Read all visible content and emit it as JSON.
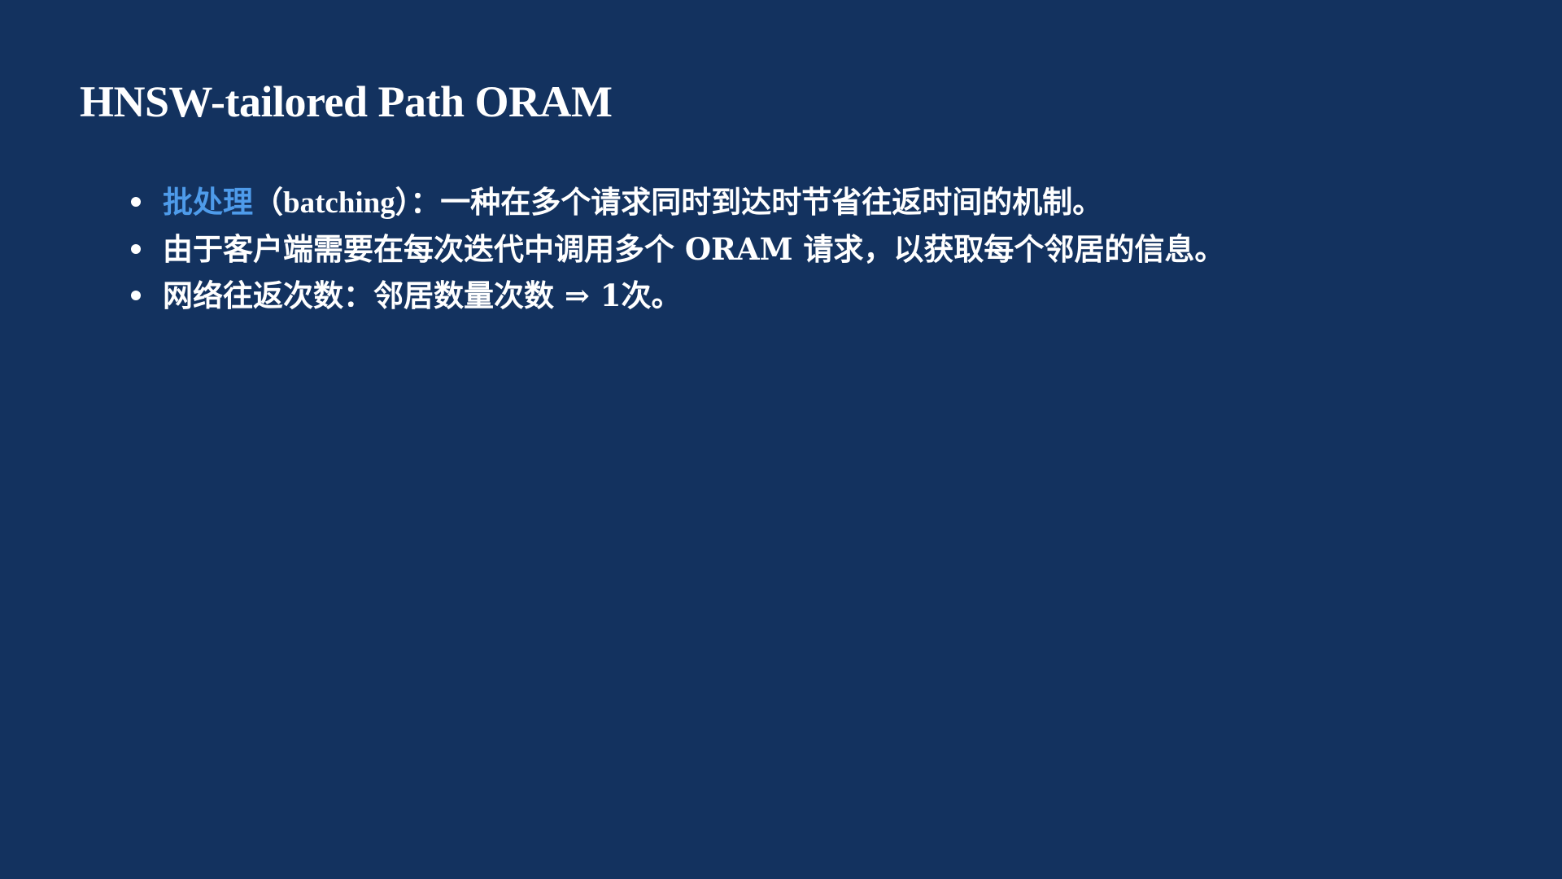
{
  "slide": {
    "title": "HNSW-tailored Path ORAM",
    "bullets": [
      {
        "highlight": "批处理",
        "paren": "（batching）",
        "rest": "：一种在多个请求同时到达时节省往返时间的机制。"
      },
      {
        "text": "由于客户端需要在每次迭代中调用多个 ORAM 请求，以获取每个邻居的信息。"
      },
      {
        "text": "网络往返次数：邻居数量次数 ⇒ 1次。"
      }
    ]
  },
  "colors": {
    "background": "#13325f",
    "text": "#ffffff",
    "accent": "#4e9bea"
  }
}
